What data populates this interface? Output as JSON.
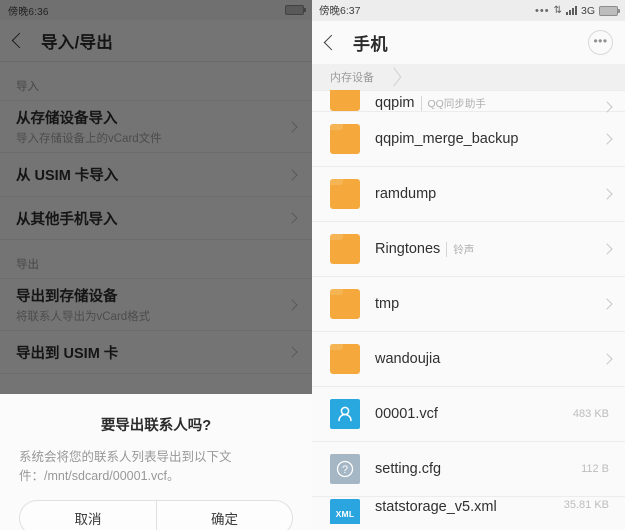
{
  "left_panel": {
    "status_bar": {
      "time": "傍晚6:36",
      "battery_icon": "battery-icon"
    },
    "title_bar": {
      "back_icon": "chevron-left-icon",
      "title": "导入/导出"
    },
    "sections": [
      {
        "header": "导入",
        "rows": [
          {
            "title": "从存储设备导入",
            "subtitle": "导入存储设备上的vCard文件"
          },
          {
            "title": "从 USIM 卡导入",
            "subtitle": ""
          },
          {
            "title": "从其他手机导入",
            "subtitle": ""
          }
        ]
      },
      {
        "header": "导出",
        "rows": [
          {
            "title": "导出到存储设备",
            "subtitle": "将联系人导出为vCard格式"
          },
          {
            "title": "导出到 USIM 卡",
            "subtitle": ""
          }
        ]
      }
    ],
    "dialog": {
      "title": "要导出联系人吗?",
      "message": "系统会将您的联系人列表导出到以下文件：/mnt/sdcard/00001.vcf。",
      "cancel_label": "取消",
      "confirm_label": "确定"
    }
  },
  "right_panel": {
    "status_bar": {
      "time": "傍晚6:37",
      "ellipsis": "•••",
      "sync_icon": "sync-arrows-icon",
      "signal_icon": "signal-bars-icon",
      "network": "3G",
      "battery_icon": "battery-icon"
    },
    "title_bar": {
      "back_icon": "chevron-left-icon",
      "title": "手机",
      "more_label": "•••"
    },
    "breadcrumb": {
      "current": "内存设备"
    },
    "files": [
      {
        "name": "qqpim",
        "alias": "QQ同步助手",
        "icon": "folder-icon",
        "size": "",
        "has_chevron": true,
        "clipped": "top"
      },
      {
        "name": "qqpim_merge_backup",
        "alias": "",
        "icon": "folder-icon",
        "size": "",
        "has_chevron": true,
        "clipped": ""
      },
      {
        "name": "ramdump",
        "alias": "",
        "icon": "folder-icon",
        "size": "",
        "has_chevron": true,
        "clipped": ""
      },
      {
        "name": "Ringtones",
        "alias": "铃声",
        "icon": "folder-icon",
        "size": "",
        "has_chevron": true,
        "clipped": ""
      },
      {
        "name": "tmp",
        "alias": "",
        "icon": "folder-icon",
        "size": "",
        "has_chevron": true,
        "clipped": ""
      },
      {
        "name": "wandoujia",
        "alias": "",
        "icon": "folder-icon",
        "size": "",
        "has_chevron": true,
        "clipped": ""
      },
      {
        "name": "00001.vcf",
        "alias": "",
        "icon": "contact-file-icon",
        "size": "483 KB",
        "has_chevron": false,
        "clipped": ""
      },
      {
        "name": "setting.cfg",
        "alias": "",
        "icon": "unknown-file-icon",
        "size": "112 B",
        "has_chevron": false,
        "clipped": ""
      },
      {
        "name": "statstorage_v5.xml",
        "alias": "",
        "icon": "xml-file-icon",
        "size": "35.81 KB",
        "has_chevron": false,
        "clipped": "bottom"
      }
    ]
  },
  "colors": {
    "folder": "#F5A93C",
    "contact_file": "#29A8E0",
    "xml_file": "#2AA5E0",
    "unknown_file": "#A5B6C4",
    "panel_bg": "#FAFAFA",
    "dim_overlay": "rgba(0,0,0,0.53)"
  }
}
